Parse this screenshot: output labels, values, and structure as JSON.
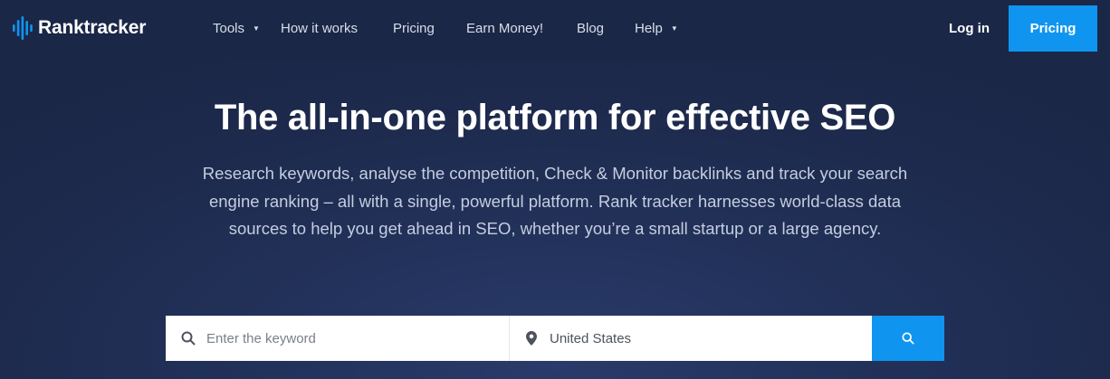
{
  "brand": {
    "name": "Ranktracker",
    "accent": "#0f95f0",
    "navbar_bg": "#1b2747"
  },
  "nav": {
    "items": [
      {
        "label": "Tools",
        "dropdown": true
      },
      {
        "label": "How it works",
        "dropdown": false
      },
      {
        "label": "Pricing",
        "dropdown": false
      },
      {
        "label": "Earn Money!",
        "dropdown": false
      },
      {
        "label": "Blog",
        "dropdown": false
      },
      {
        "label": "Help",
        "dropdown": true
      }
    ],
    "caret": "▼",
    "login_label": "Log in",
    "cta_label": "Pricing"
  },
  "hero": {
    "title": "The all-in-one platform for effective SEO",
    "subtitle": "Research keywords, analyse the competition, Check & Monitor backlinks and track your search engine ranking – all with a single, powerful platform. Rank tracker harnesses world-class data sources to help you get ahead in SEO, whether you’re a small startup or a large agency."
  },
  "search": {
    "keyword_placeholder": "Enter the keyword",
    "keyword_value": "",
    "location_value": "United States",
    "icons": {
      "keyword": "search-icon",
      "location": "map-pin-icon",
      "submit": "search-icon"
    }
  }
}
